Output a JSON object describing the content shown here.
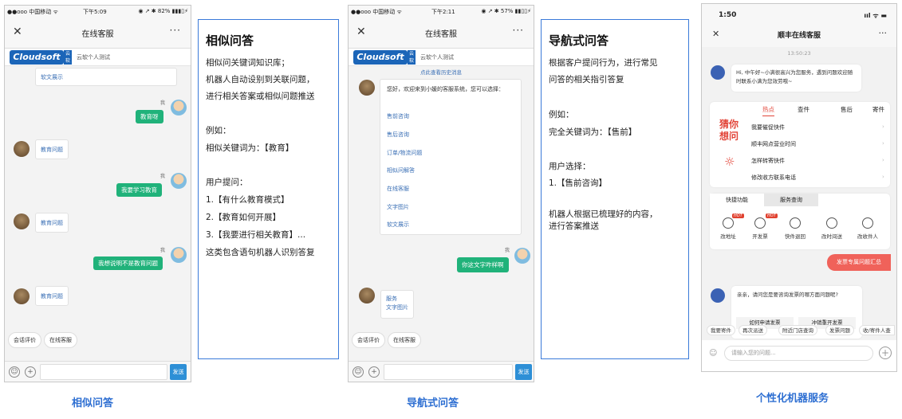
{
  "phone1": {
    "status": {
      "carrier": "●●ooo 中国移动 ᯤ",
      "time": "下午5:09",
      "right": "◉ ↗ ✱ 82% ▮▮▮▯⚡"
    },
    "header": {
      "close": "✕",
      "title": "在线客服",
      "more": "···"
    },
    "brand": {
      "logo": "Cloudsoft",
      "logo_tag": "云软",
      "subtitle": "云软个人测试"
    },
    "messages": [
      "软文展示",
      "我",
      "教育呀",
      "教育问题",
      "我",
      "我要学习教育",
      "教育问题",
      "我",
      "我想说明不是教育问题",
      "教育问题"
    ],
    "quick": [
      "会话评价",
      "在线客服"
    ],
    "send": "发送"
  },
  "box1": {
    "title": "相似问答",
    "lines": [
      "相似问关键词知识库；",
      "机器人自动设别到关联问题，",
      "进行相关答案或相似问题推送",
      "例如：",
      "相似关键词为：【教育】",
      "用户提问：",
      "1.【有什么教育模式】",
      "2.【教育如何开展】",
      "3.【我要进行相关教育】...",
      "这类包含语句机器人识别答复"
    ]
  },
  "phone2": {
    "status": {
      "carrier": "●●ooo 中国移动 ᯤ",
      "time": "下午2:11",
      "right": "◉ ↗ ✱ 57% ▮▮▯▯⚡"
    },
    "header": {
      "close": "✕",
      "title": "在线客服",
      "more": "···"
    },
    "brand": {
      "logo": "Cloudsoft",
      "logo_tag": "云软",
      "subtitle": "云软个人测试"
    },
    "history": "点此查看历史消息",
    "welcome": "您好，欢迎来到小媛的客服系统，您可以选择：",
    "options": [
      "售前咨询",
      "售后咨询",
      "订单/物流问题",
      "相似问解答",
      "在线客服",
      "文字图片",
      "软文展示"
    ],
    "me": "我",
    "user_msg": "你这文字咋样啊",
    "reply": [
      "服务",
      "文字图片"
    ],
    "quick": [
      "会话评价",
      "在线客服"
    ],
    "send": "发送"
  },
  "box2": {
    "title": "导航式问答",
    "lines": [
      "根据客户提问行为，进行常见",
      "问答的相关指引答复",
      "例如：",
      "完全关键词为：【售前】",
      "用户选择：",
      "1.【售前咨询】",
      "机器人根据已梳理好的内容，",
      "进行答案推送"
    ]
  },
  "phone3": {
    "status": {
      "time": "1:50",
      "right": "ııl ᯤ ▬"
    },
    "header": {
      "close": "✕",
      "title": "顺丰在线客服",
      "more": "···"
    },
    "timestamp": "13:50:23",
    "greeting": "Hi, 中午好~小满很高兴为您服务，遇到问题欢迎随时联系小满为您效劳哦~",
    "tabs": [
      "热点",
      "查件",
      "售后",
      "寄件"
    ],
    "guess": "猜你想问",
    "hot_items": [
      "我要催促快件",
      "顺丰网点营业时间",
      "怎样转寄快件",
      "修改收方联系电话"
    ],
    "func_tabs": [
      "快捷功能",
      "服务查询"
    ],
    "services": [
      "改地址",
      "开发票",
      "快件退回",
      "改时间送",
      "改收件人"
    ],
    "hot_tag": "HOT",
    "hot_button": "发票专属问题汇总",
    "invoice_q": "亲亲，请问您是要咨询发票的哪方面问题呢?",
    "invoice_opts": [
      "如何申请发票",
      "冲销重开发票"
    ],
    "chips": [
      "我要寄件",
      "再次派送",
      "附近门店查询",
      "发票问题",
      "收/寄件人查"
    ],
    "input_placeholder": "请输入您的问题..."
  },
  "captions": [
    "相似问答",
    "导航式问答",
    "个性化机器服务"
  ]
}
